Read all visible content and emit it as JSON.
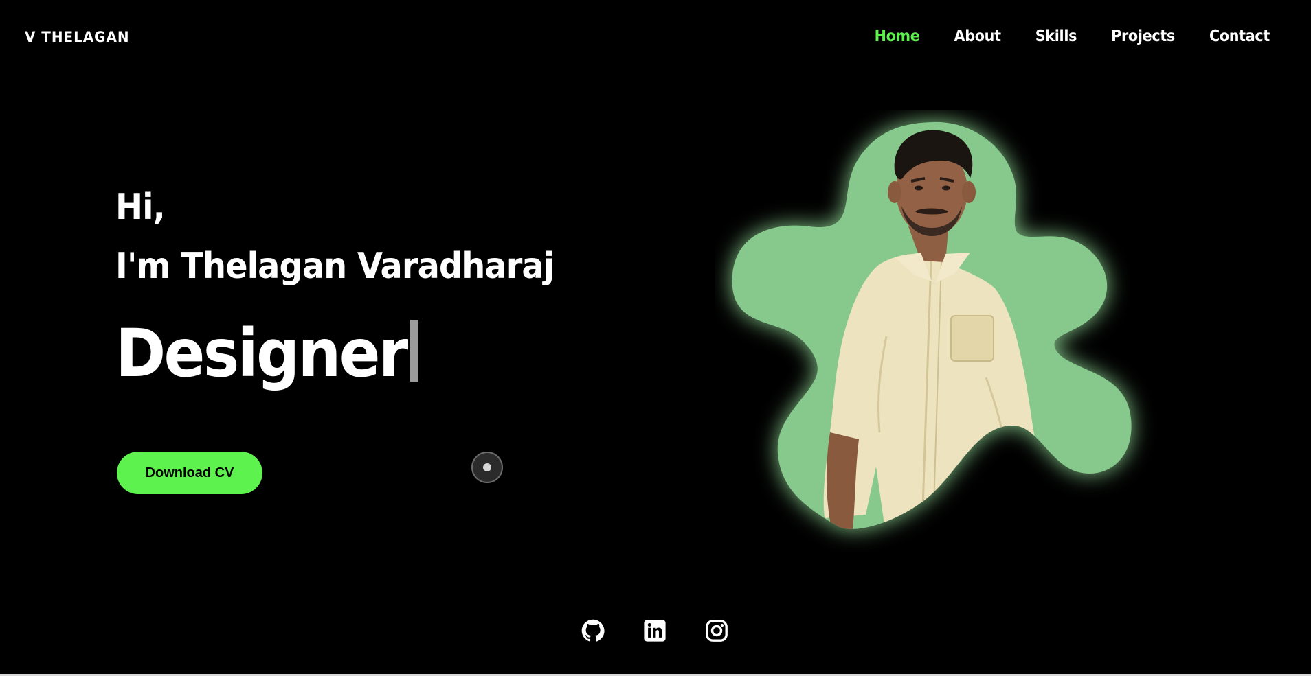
{
  "header": {
    "logo": "V THELAGAN",
    "nav": [
      {
        "label": "Home",
        "active": true
      },
      {
        "label": "About",
        "active": false
      },
      {
        "label": "Skills",
        "active": false
      },
      {
        "label": "Projects",
        "active": false
      },
      {
        "label": "Contact",
        "active": false
      }
    ]
  },
  "hero": {
    "greeting": "Hi,",
    "intro": "I'm Thelagan Varadharaj",
    "role": "Designer",
    "cta_label": "Download CV"
  },
  "socials": [
    {
      "icon": "github-icon"
    },
    {
      "icon": "linkedin-icon"
    },
    {
      "icon": "instagram-icon"
    }
  ],
  "colors": {
    "background": "#000000",
    "accent": "#5ef24f",
    "blob": "#87c98c",
    "text": "#ffffff"
  }
}
